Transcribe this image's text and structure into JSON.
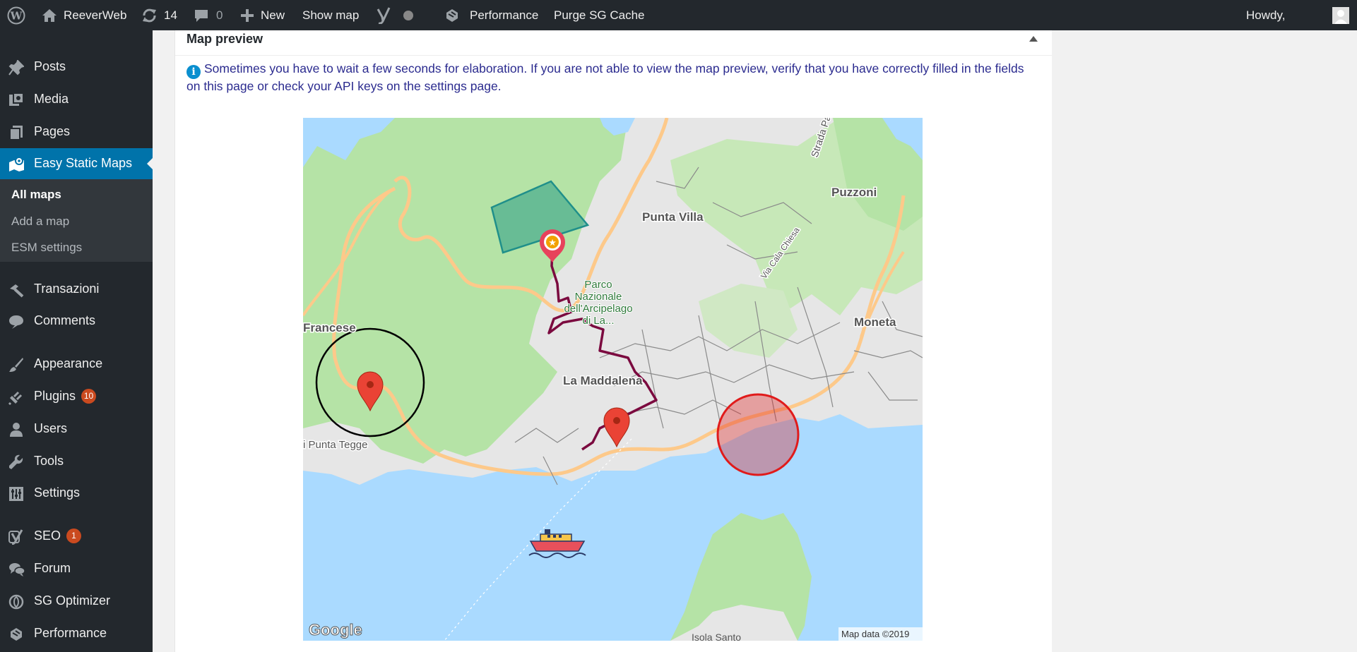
{
  "admin_bar": {
    "site_name": "ReeverWeb",
    "updates_count": "14",
    "comments_count": "0",
    "new_label": "New",
    "show_map_label": "Show map",
    "performance_label": "Performance",
    "purge_label": "Purge SG Cache",
    "howdy_label": "Howdy,",
    "icons": [
      "wordpress-logo-icon",
      "home-icon",
      "updates-icon",
      "comment-icon",
      "plus-icon",
      "yoast-icon",
      "status-dot-icon",
      "performance-icon",
      "avatar-icon"
    ]
  },
  "sidebar": {
    "items": [
      {
        "label": "Posts",
        "icon": "pushpin-icon"
      },
      {
        "label": "Media",
        "icon": "media-icon"
      },
      {
        "label": "Pages",
        "icon": "pages-icon"
      },
      {
        "label": "Easy Static Maps",
        "icon": "map-icon"
      },
      {
        "label": "Transazioni",
        "icon": "hammer-icon"
      },
      {
        "label": "Comments",
        "icon": "comment-icon"
      },
      {
        "label": "Appearance",
        "icon": "brush-icon"
      },
      {
        "label": "Plugins",
        "icon": "plugin-icon",
        "badge": "10"
      },
      {
        "label": "Users",
        "icon": "user-icon"
      },
      {
        "label": "Tools",
        "icon": "wrench-icon"
      },
      {
        "label": "Settings",
        "icon": "sliders-icon"
      },
      {
        "label": "SEO",
        "icon": "yoast-icon",
        "badge": "1"
      },
      {
        "label": "Forum",
        "icon": "forum-icon"
      },
      {
        "label": "SG Optimizer",
        "icon": "sg-icon"
      },
      {
        "label": "Performance",
        "icon": "performance-icon"
      }
    ],
    "submenu": [
      {
        "label": "All maps"
      },
      {
        "label": "Add a map"
      },
      {
        "label": "ESM settings"
      }
    ]
  },
  "metabox": {
    "title": "Map preview",
    "notice": "Sometimes you have to wait a few seconds for elaboration. If you are not able to view the map preview, verify that you have correctly filled in the fields on this page or check your API keys on the settings page."
  },
  "map": {
    "labels": {
      "punta_villa": "Punta Villa",
      "puzzoni": "Puzzoni",
      "strada": "Strada Pa",
      "via_cala_chiesa": "Via Cala Chiesa",
      "parco_1": "Parco",
      "parco_2": "Nazionale",
      "parco_3": "dell'Arcipelago",
      "parco_4": "di La...",
      "francese": "Francese",
      "moneta": "Moneta",
      "la_maddalena": "La Maddalena",
      "punta_tegge": "i Punta Tegge",
      "isola_santo": "Isola Santo",
      "google": "Google",
      "attribution": "Map data ©2019"
    },
    "colors": {
      "water": "#aadaff",
      "land_green": "#b5e3a6",
      "urban": "#e6e6e6",
      "road": "#fdc98a",
      "route": "#7b0a3f",
      "polygon": "#3fa88c",
      "circle_black": "#000000",
      "circle_red": "#e01b1b"
    }
  }
}
